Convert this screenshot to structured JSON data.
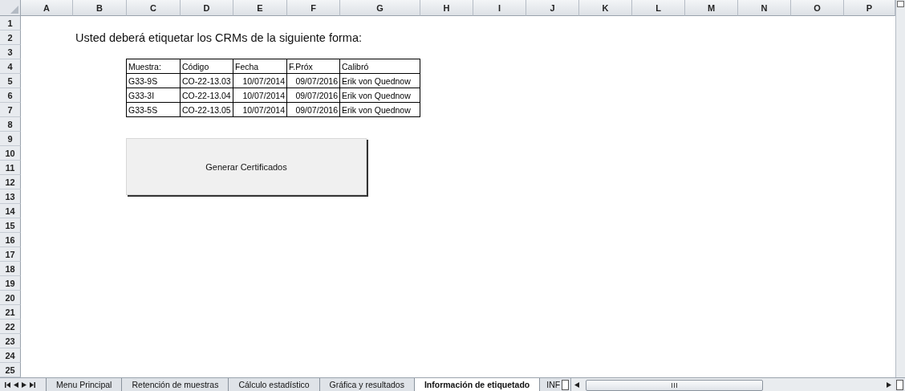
{
  "columns": [
    "A",
    "B",
    "C",
    "D",
    "E",
    "F",
    "G",
    "H",
    "I",
    "J",
    "K",
    "L",
    "M",
    "N",
    "O",
    "P"
  ],
  "rows": [
    "1",
    "2",
    "3",
    "4",
    "5",
    "6",
    "7",
    "8",
    "9",
    "10",
    "11",
    "12",
    "13",
    "14",
    "15",
    "16",
    "17",
    "18",
    "19",
    "20",
    "21",
    "22",
    "23",
    "24",
    "25"
  ],
  "heading": "Usted deberá etiquetar los CRMs de la siguiente forma:",
  "table": {
    "columns": [
      {
        "label": "Muestra:",
        "kind": "text"
      },
      {
        "label": "Código",
        "kind": "text"
      },
      {
        "label": "Fecha",
        "kind": "date"
      },
      {
        "label": "F.Próx",
        "kind": "date"
      },
      {
        "label": "Calibró",
        "kind": "text"
      }
    ],
    "rows": [
      [
        "G33-9S",
        "CO-22-13.03",
        "10/07/2014",
        "09/07/2016",
        "Erik von Quednow"
      ],
      [
        "G33-3I",
        "CO-22-13.04",
        "10/07/2014",
        "09/07/2016",
        "Erik von Quednow"
      ],
      [
        "G33-5S",
        "CO-22-13.05",
        "10/07/2014",
        "09/07/2016",
        "Erik von Quednow"
      ]
    ]
  },
  "button": "Generar Certificados",
  "sheet_tabs": [
    {
      "label": "Menu Principal",
      "selected": false
    },
    {
      "label": "Retención de muestras",
      "selected": false
    },
    {
      "label": "Cálculo estadístico",
      "selected": false
    },
    {
      "label": "Gráfica y resultados",
      "selected": false
    },
    {
      "label": "Información de etiquetado",
      "selected": true
    },
    {
      "label": "INF",
      "selected": false
    }
  ]
}
